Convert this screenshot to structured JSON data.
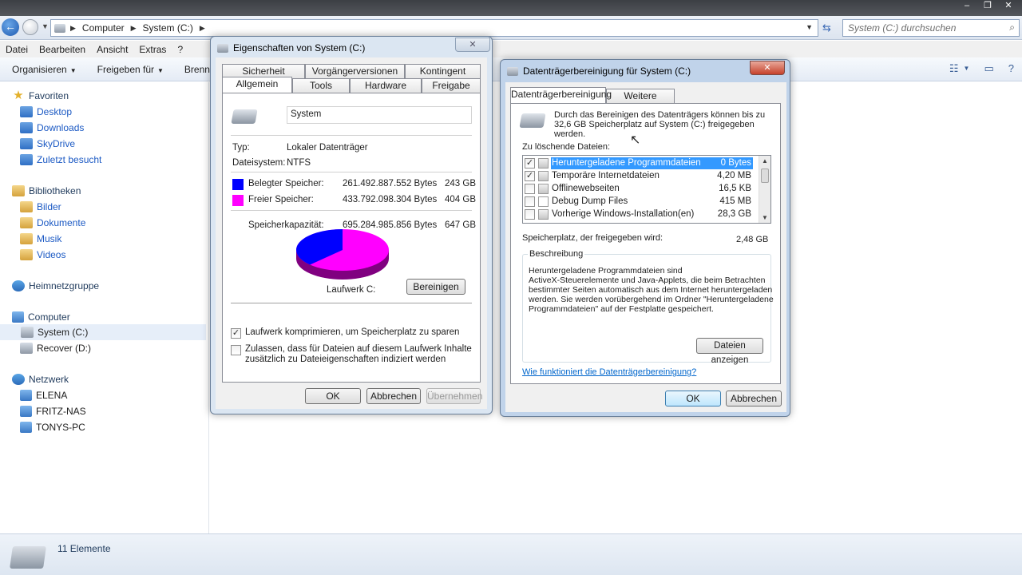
{
  "explorer": {
    "window_controls": [
      "–",
      "❐",
      "✕"
    ],
    "back_icon": "back-arrow-icon",
    "breadcrumb": [
      "Computer",
      "System (C:)"
    ],
    "search_placeholder": "System (C:) durchsuchen",
    "menu": [
      "Datei",
      "Bearbeiten",
      "Ansicht",
      "Extras",
      "?"
    ],
    "toolbar": [
      "Organisieren",
      "Freigeben für",
      "Brennen"
    ],
    "nav": {
      "favorites": {
        "label": "Favoriten",
        "items": [
          "Desktop",
          "Downloads",
          "SkyDrive",
          "Zuletzt besucht"
        ]
      },
      "libraries": {
        "label": "Bibliotheken",
        "items": [
          "Bilder",
          "Dokumente",
          "Musik",
          "Videos"
        ]
      },
      "homegroup": "Heimnetzgruppe",
      "computer": {
        "label": "Computer",
        "items": [
          "System (C:)",
          "Recover (D:)"
        ],
        "selected": "System (C:)"
      },
      "network": {
        "label": "Netzwerk",
        "items": [
          "ELENA",
          "FRITZ-NAS",
          "TONYS-PC"
        ]
      }
    },
    "status": "11 Elemente"
  },
  "properties": {
    "title": "Eigenschaften von System (C:)",
    "tabs_row1": [
      "Sicherheit",
      "Vorgängerversionen",
      "Kontingent"
    ],
    "tabs_row2": [
      "Allgemein",
      "Tools",
      "Hardware",
      "Freigabe"
    ],
    "active_tab": "Allgemein",
    "name_value": "System",
    "type_label": "Typ:",
    "type_value": "Lokaler Datenträger",
    "fs_label": "Dateisystem:",
    "fs_value": "NTFS",
    "used_label": "Belegter Speicher:",
    "used_bytes": "261.492.887.552 Bytes",
    "used_gb": "243 GB",
    "free_label": "Freier Speicher:",
    "free_bytes": "433.792.098.304 Bytes",
    "free_gb": "404 GB",
    "capacity_label": "Speicherkapazität:",
    "capacity_bytes": "695.284.985.856 Bytes",
    "capacity_gb": "647 GB",
    "drive_label": "Laufwerk C:",
    "cleanup_button": "Bereinigen",
    "compress_label": "Laufwerk komprimieren, um Speicherplatz zu sparen",
    "compress_checked": true,
    "index_label_1": "Zulassen, dass für Dateien auf diesem Laufwerk Inhalte",
    "index_label_2": "zusätzlich zu Dateieigenschaften indiziert werden",
    "index_checked": false,
    "ok": "OK",
    "cancel": "Abbrechen",
    "apply": "Übernehmen",
    "colors": {
      "used": "#0000ff",
      "free": "#ff00ff"
    },
    "used_fraction": 0.376
  },
  "cleanup": {
    "title": "Datenträgerbereinigung für System (C:)",
    "tabs": [
      "Datenträgerbereinigung",
      "Weitere Optionen"
    ],
    "intro_1": "Durch das Bereinigen des Datenträgers können bis zu",
    "intro_2": "32,6 GB Speicherplatz auf System (C:) freigegeben",
    "intro_3": "werden.",
    "files_label": "Zu löschende Dateien:",
    "files": [
      {
        "name": "Heruntergeladene Programmdateien",
        "size": "0 Bytes",
        "checked": true,
        "selected": true
      },
      {
        "name": "Temporäre Internetdateien",
        "size": "4,20 MB",
        "checked": true,
        "selected": false
      },
      {
        "name": "Offlinewebseiten",
        "size": "16,5 KB",
        "checked": false,
        "selected": false
      },
      {
        "name": "Debug Dump Files",
        "size": "415 MB",
        "checked": false,
        "selected": false
      },
      {
        "name": "Vorherige Windows-Installation(en)",
        "size": "28,3 GB",
        "checked": false,
        "selected": false
      }
    ],
    "freed_label": "Speicherplatz, der freigegeben wird:",
    "freed_value": "2,48 GB",
    "description_label": "Beschreibung",
    "description_lines": [
      "Heruntergeladene Programmdateien sind",
      "ActiveX-Steuerelemente und Java-Applets, die beim Betrachten",
      "bestimmter Seiten automatisch aus dem Internet heruntergeladen",
      "werden. Sie werden vorübergehend im Ordner \"Heruntergeladene",
      "Programmdateien\" auf der Festplatte gespeichert."
    ],
    "view_files": "Dateien anzeigen",
    "help_link": "Wie funktioniert die Datenträgerbereinigung?",
    "ok": "OK",
    "cancel": "Abbrechen"
  }
}
